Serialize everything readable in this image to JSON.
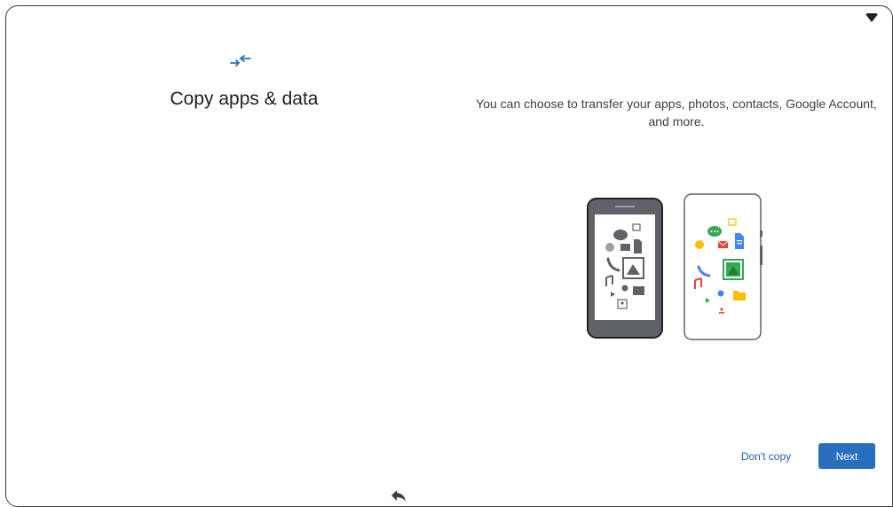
{
  "setup": {
    "title": "Copy apps & data",
    "description": "You can choose to transfer your apps, photos, contacts, Google Account, and more.",
    "dont_copy_label": "Don't copy",
    "next_label": "Next"
  },
  "icons": {
    "header": "transfer-arrows-icon",
    "status": "wifi-icon",
    "nav": "back-icon",
    "illustration": "phone-transfer-illustration"
  },
  "colors": {
    "accent": "#2a6ebf",
    "link": "#1a5fae",
    "title_text": "#202124",
    "body_text": "#3c4043"
  }
}
